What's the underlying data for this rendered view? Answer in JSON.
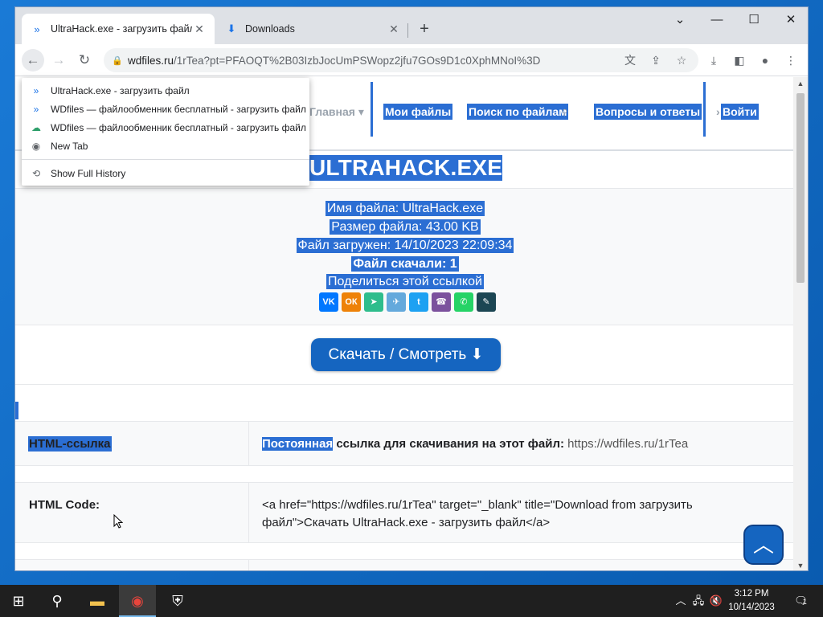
{
  "browser": {
    "tabs": [
      {
        "title": "UltraHack.exe - загрузить файл",
        "icon": "wdfiles-chevron-icon",
        "active": true
      },
      {
        "title": "Downloads",
        "icon": "download-icon",
        "active": false
      }
    ],
    "new_tab": "+",
    "controls": {
      "minimize": "—",
      "maximize": "☐",
      "close": "✕",
      "chevron": "⌄"
    },
    "url_domain": "wdfiles.ru",
    "url_path": "/1rTea?pt=PFAOQT%2B03IzbJocUmPSWopz2jfu7GOs9D1c0XphMNoI%3D"
  },
  "history_menu": {
    "items": [
      {
        "label": "UltraHack.exe - загрузить файл",
        "icon": "wdfiles-chevron-icon"
      },
      {
        "label": "WDfiles — файлообменник бесплатный - загрузить файл",
        "icon": "wdfiles-chevron-icon"
      },
      {
        "label": "WDfiles — файлообменник бесплатный - загрузить файл",
        "icon": "cloud-icon"
      },
      {
        "label": "New Tab",
        "icon": "chrome-icon"
      }
    ],
    "show_full_history": "Show Full History"
  },
  "site": {
    "nav": {
      "home": "Главная ▾",
      "my_files": "Мои файлы",
      "search": "Поиск по файлам",
      "search_glyph": "🔍",
      "faq": "Вопросы и ответы",
      "login_arrow": "›",
      "login": "Войти"
    },
    "file_title": "ULTRAHACK.EXE",
    "info": {
      "name": "Имя файла: UltraHack.exe",
      "size": "Размер файла: 43.00 KB",
      "uploaded": "Файл загружен: 14/10/2023 22:09:34",
      "downloads": "Файл скачали: 1",
      "share": "Поделиться этой ссылкой"
    },
    "share_buttons": [
      {
        "name": "vk-icon",
        "glyph": "VK",
        "color": "#0077ff"
      },
      {
        "name": "odnoklassniki-icon",
        "glyph": "ОК",
        "color": "#ee8208"
      },
      {
        "name": "send-icon",
        "glyph": "➤",
        "color": "#2ebd8c"
      },
      {
        "name": "telegram-icon",
        "glyph": "✈",
        "color": "#64a9dc"
      },
      {
        "name": "twitter-icon",
        "glyph": "t",
        "color": "#1da1f2"
      },
      {
        "name": "viber-icon",
        "glyph": "☎",
        "color": "#7b519d"
      },
      {
        "name": "whatsapp-icon",
        "glyph": "✆",
        "color": "#25d366"
      },
      {
        "name": "livejournal-icon",
        "glyph": "✎",
        "color": "#1c4653"
      }
    ],
    "download_button": "Скачать / Смотреть ⬇",
    "rows": [
      {
        "label": "HTML-ссылка",
        "value_highlight": "Постоянная",
        "value_bold": " ссылка для скачивания на этот файл:",
        "value_link": " https://wdfiles.ru/1rTea"
      },
      {
        "label": "HTML Code:",
        "value_line1": "<a href=\"https://wdfiles.ru/1rTea\" target=\"_blank\" title=\"Download from загрузить",
        "value_line2": "файл\">Скачать UltraHack.exe - загрузить файл</a>"
      }
    ],
    "to_top": "︿"
  },
  "taskbar": {
    "time": "3:12 PM",
    "date": "10/14/2023",
    "notification_count": "1"
  }
}
